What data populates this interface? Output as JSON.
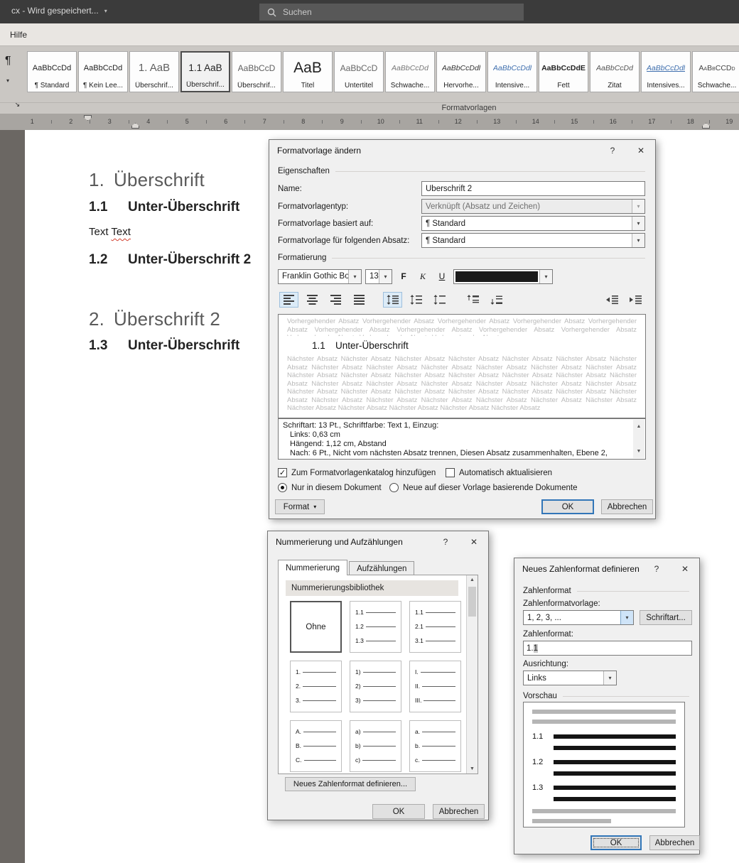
{
  "glyphs": {
    "caret": "▾",
    "chevron": "▾",
    "pilcrow": "¶",
    "help": "?",
    "close": "✕",
    "up": "▲",
    "down": "▼",
    "launcher": "↘",
    "check": "✓"
  },
  "titlebar": {
    "document": "cx  - Wird gespeichert...",
    "search_placeholder": "Suchen"
  },
  "menubar": {
    "help": "Hilfe"
  },
  "ribbon": {
    "caption": "Formatvorlagen",
    "gallery": [
      {
        "sample": "AaBbCcDd",
        "label": "¶ Standard",
        "cls": "s-body"
      },
      {
        "sample": "AaBbCcDd",
        "label": "¶ Kein Lee...",
        "cls": "s-body"
      },
      {
        "sample": "1. AaB",
        "label": "Überschrif...",
        "cls": "s-h1"
      },
      {
        "sample": "1.1 AaB",
        "label": "Überschrif...",
        "cls": "s-h2 selected"
      },
      {
        "sample": "AaBbCcD",
        "label": "Überschrif...",
        "cls": "s-h3"
      },
      {
        "sample": "AaB",
        "label": "Titel",
        "cls": "s-title"
      },
      {
        "sample": "AaBbCcD",
        "label": "Untertitel",
        "cls": "s-subtitle"
      },
      {
        "sample": "AaBbCcDd",
        "label": "Schwache...",
        "cls": "s-subtle-em"
      },
      {
        "sample": "AaBbCcDdl",
        "label": "Hervorhe...",
        "cls": "s-em"
      },
      {
        "sample": "AaBbCcDdl",
        "label": "Intensive...",
        "cls": "s-intense-em"
      },
      {
        "sample": "AaBbCcDdE",
        "label": "Fett",
        "cls": "s-bold"
      },
      {
        "sample": "AaBbCcDd",
        "label": "Zitat",
        "cls": "s-quote"
      },
      {
        "sample": "AaBbCcDdl",
        "label": "Intensives...",
        "cls": "s-intense-ref"
      },
      {
        "sample": "AaBbCCDd",
        "label": "Schwache...",
        "cls": "s-subtle-ref"
      }
    ]
  },
  "ruler": {
    "numbers": [
      "1",
      "2",
      "3",
      "4",
      "5",
      "6",
      "7",
      "8",
      "9",
      "10",
      "11",
      "12",
      "13",
      "14",
      "15",
      "16",
      "17",
      "18",
      "19"
    ]
  },
  "doc": {
    "h1a": {
      "num": "1.",
      "text": "Überschrift"
    },
    "h2a": {
      "num": "1.1",
      "text": "Unter-Überschrift"
    },
    "body": {
      "w1": "Text",
      "w2": "Text"
    },
    "h2b": {
      "num": "1.2",
      "text": "Unter-Überschrift 2"
    },
    "h1b": {
      "num": "2.",
      "text": "Überschrift 2"
    },
    "h2c": {
      "num": "1.3",
      "text": "Unter-Überschrift"
    }
  },
  "dlg_style": {
    "title": "Formatvorlage ändern",
    "group_properties": "Eigenschaften",
    "group_formatting": "Formatierung",
    "name_label": "Name:",
    "name_value": "Überschrift 2",
    "type_label": "Formatvorlagentyp:",
    "type_value": "Verknüpft (Absatz und Zeichen)",
    "basedon_label": "Formatvorlage basiert auf:",
    "basedon_value": "¶ Standard",
    "next_label": "Formatvorlage für folgenden Absatz:",
    "next_value": "¶ Standard",
    "font_name": "Franklin Gothic Bo",
    "font_size": "13",
    "btn_bold": "F",
    "btn_italic": "K",
    "btn_underline": "U",
    "preview": {
      "prev": "Vorhergehender Absatz Vorhergehender Absatz Vorhergehender Absatz Vorhergehender Absatz Vorhergehender Absatz Vorhergehender Absatz Vorhergehender Absatz Vorhergehender Absatz Vorhergehender Absatz Vorhergehender Absatz Vorhergehender Absatz Vorhergehender Absatz",
      "num": "1.1",
      "text": "Unter-Überschrift",
      "next": "Nächster Absatz Nächster Absatz Nächster Absatz Nächster Absatz Nächster Absatz Nächster Absatz Nächster Absatz Nächster Absatz Nächster Absatz Nächster Absatz Nächster Absatz Nächster Absatz Nächster Absatz Nächster Absatz Nächster Absatz Nächster Absatz Nächster Absatz Nächster Absatz Nächster Absatz Nächster Absatz Nächster Absatz Nächster Absatz Nächster Absatz Nächster Absatz Nächster Absatz Nächster Absatz Nächster Absatz Nächster Absatz Nächster Absatz Nächster Absatz Nächster Absatz Nächster Absatz Nächster Absatz Nächster Absatz Nächster Absatz Nächster Absatz Nächster Absatz Nächster Absatz Nächster Absatz Nächster Absatz Nächster Absatz Nächster Absatz Nächster Absatz Nächster Absatz"
    },
    "desc": [
      "Schriftart: 13 Pt., Schriftfarbe: Text 1, Einzug:",
      "Links:  0,63 cm",
      "Hängend:  1,12 cm, Abstand",
      "Nach:  6 Pt., Nicht vom nächsten Absatz trennen, Diesen Absatz zusammenhalten, Ebene 2,"
    ],
    "check1": "Zum Formatvorlagenkatalog hinzufügen",
    "check2": "Automatisch aktualisieren",
    "radio1": "Nur in diesem Dokument",
    "radio2": "Neue auf dieser Vorlage basierende Dokumente",
    "format_btn": "Format",
    "ok": "OK",
    "cancel": "Abbrechen"
  },
  "dlg_numbering": {
    "title": "Nummerierung und Aufzählungen",
    "tab1": "Nummerierung",
    "tab2": "Aufzählungen",
    "library": "Nummerierungsbibliothek",
    "cells": {
      "ohne": "Ohne",
      "r1c2": [
        "1.1",
        "1.2",
        "1.3"
      ],
      "r1c3": [
        "1.1",
        "2.1",
        "3.1"
      ],
      "r2c1": [
        "1.",
        "2.",
        "3."
      ],
      "r2c2": [
        "1)",
        "2)",
        "3)"
      ],
      "r2c3": [
        "I.",
        "II.",
        "III."
      ],
      "r3c1": [
        "A.",
        "B.",
        "C."
      ],
      "r3c2": [
        "a)",
        "b)",
        "c)"
      ],
      "r3c3": [
        "a.",
        "b.",
        "c."
      ]
    },
    "new_btn": "Neues Zahlenformat definieren...",
    "ok": "OK",
    "cancel": "Abbrechen"
  },
  "dlg_numformat": {
    "title": "Neues Zahlenformat definieren",
    "group_format": "Zahlenformat",
    "style_label": "Zahlenformatvorlage:",
    "style_value": "1, 2, 3, ...",
    "font_btn": "Schriftart...",
    "format_label": "Zahlenformat:",
    "format_prefix": "1.",
    "format_field": "1",
    "align_label": "Ausrichtung:",
    "align_value": "Links",
    "group_preview": "Vorschau",
    "items": [
      "1.1",
      "1.2",
      "1.3"
    ],
    "ok": "OK",
    "cancel": "Abbrechen"
  }
}
